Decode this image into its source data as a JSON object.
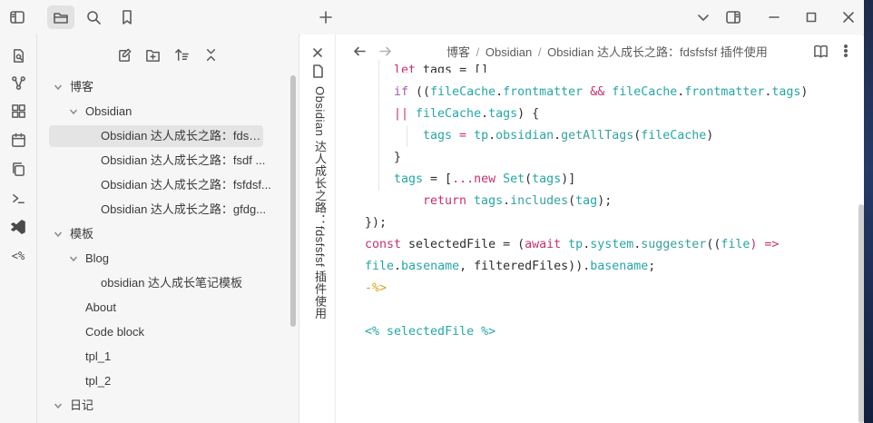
{
  "breadcrumb": {
    "part1": "博客",
    "sep1": "/",
    "part2": "Obsidian",
    "sep2": "/",
    "part3": "Obsidian 达人成长之路：fdsfsfsf 插件使用"
  },
  "tab": {
    "vertical_title": "Obsidian 达人成长之路：fdsfsfsf 插件使用"
  },
  "tree": [
    {
      "label": "博客",
      "level": 0,
      "type": "folder"
    },
    {
      "label": "Obsidian",
      "level": 1,
      "type": "folder"
    },
    {
      "label": "Obsidian 达人成长之路：fdsfsf...",
      "level": 2,
      "type": "file",
      "active": true
    },
    {
      "label": "Obsidian 达人成长之路：fsdf ...",
      "level": 2,
      "type": "file"
    },
    {
      "label": "Obsidian 达人成长之路：fsfdsf...",
      "level": 2,
      "type": "file"
    },
    {
      "label": "Obsidian 达人成长之路：gfdg...",
      "level": 2,
      "type": "file"
    },
    {
      "label": "模板",
      "level": 0,
      "type": "folder"
    },
    {
      "label": "Blog",
      "level": 1,
      "type": "folder"
    },
    {
      "label": "obsidian 达人成长笔记模板",
      "level": 2,
      "type": "file"
    },
    {
      "label": "About",
      "level": 1,
      "type": "file"
    },
    {
      "label": "Code block",
      "level": 1,
      "type": "file"
    },
    {
      "label": "tpl_1",
      "level": 1,
      "type": "file"
    },
    {
      "label": "tpl_2",
      "level": 1,
      "type": "file"
    },
    {
      "label": "日记",
      "level": 0,
      "type": "folder"
    }
  ],
  "code": {
    "l1_kw": "let",
    "l1_rest": " tags = []",
    "l2_if": "if",
    "l2_a": " ((",
    "l2_b": "fileCache",
    "l2_c": ".",
    "l2_d": "frontmatter",
    "l2_e": " && ",
    "l2_f": "fileCache",
    "l2_g": ".",
    "l2_h": "frontmatter",
    "l2_i": ".",
    "l2_j": "tags",
    "l2_k": ")",
    "l3_or": "||",
    "l3_a": " fileCache",
    "l3_b": ".",
    "l3_c": "tags",
    "l3_d": ") {",
    "l4_a": "tags",
    "l4_b": " = ",
    "l4_c": "tp",
    "l4_d": ".",
    "l4_e": "obsidian",
    "l4_f": ".",
    "l4_g": "getAllTags",
    "l4_h": "(",
    "l4_i": "fileCache",
    "l4_j": ")",
    "l5": "}",
    "l6_a": "tags",
    "l6_b": " = [",
    "l6_c": "...",
    "l6_d": "new",
    "l6_e": " Set",
    "l6_f": "(",
    "l6_g": "tags",
    "l6_h": ")]",
    "l7_a": "return",
    "l7_b": " tags",
    "l7_c": ".",
    "l7_d": "includes",
    "l7_e": "(",
    "l7_f": "tag",
    "l7_g": ");",
    "l8": "});",
    "l9_a": "const",
    "l9_b": " selectedFile = (",
    "l9_c": "await",
    "l9_d": " tp",
    "l9_e": ".",
    "l9_f": "system",
    "l9_g": ".",
    "l9_h": "suggester",
    "l9_i": "((",
    "l9_j": "file",
    "l9_k": ") =>",
    "l10_a": "file",
    "l10_b": ".",
    "l10_c": "basename",
    "l10_d": ", filteredFiles)",
    "l10_e": ").",
    "l10_f": "basename",
    "l10_g": ";",
    "l11": "-%>",
    "l12_a": "<%",
    "l12_b": " selectedFile ",
    "l12_c": "%>"
  },
  "colors": {
    "accent_keyword": "#a15ca6",
    "accent_operator": "#c9306e",
    "accent_property": "#27a6a6",
    "accent_template": "#d8a01d"
  }
}
